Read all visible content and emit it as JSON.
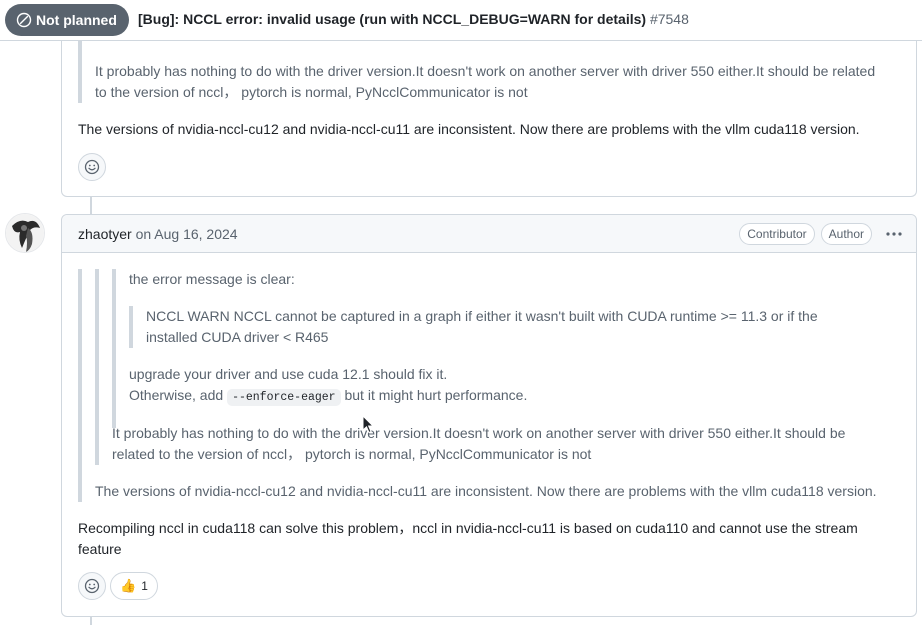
{
  "header": {
    "state": "Not planned",
    "title": "[Bug]: NCCL error: invalid usage (run with NCCL_DEBUG=WARN for details)",
    "number": "#7548"
  },
  "comment1": {
    "quote": "It probably has nothing to do with the driver version.It doesn't work on another server with driver 550 either.It should be related to the version of nccl， pytorch is normal, PyNcclCommunicator is not",
    "quote_line1": "It probably has nothing to do with the driver version.It doesn't work on another server with driver 550 either.It should be related",
    "quote_line2": "to the version of nccl， pytorch is normal, PyNcclCommunicator is not",
    "body": "The versions of nvidia-nccl-cu12 and nvidia-nccl-cu11 are inconsistent. Now there are problems with the vllm cuda118 version."
  },
  "comment2": {
    "author": "zhaotyer",
    "date": "on Aug 16, 2024",
    "labels": [
      "Contributor",
      "Author"
    ],
    "q3_intro": "the error message is clear:",
    "q4_line1": "NCCL WARN NCCL cannot be captured in a graph if either it wasn't built with CUDA runtime >= 11.3 or if the",
    "q4_line2": "installed CUDA driver < R465",
    "q3_upgrade": "upgrade your driver and use cuda 12.1 should fix it.",
    "q3_otherwise_pre": "Otherwise, add",
    "q3_code": "--enforce-eager",
    "q3_otherwise_post": "but it might hurt performance.",
    "q2_line1": "It probably has nothing to do with the driver version.It doesn't work on another server with driver 550 either.It should be",
    "q2_line2": "related to the version of nccl， pytorch is normal, PyNcclCommunicator is not",
    "q1_text": "The versions of nvidia-nccl-cu12 and nvidia-nccl-cu11 are inconsistent. Now there are problems with the vllm cuda118 version.",
    "body_line1": "Recompiling nccl in cuda118 can solve this problem，nccl in nvidia-nccl-cu11 is based on cuda110 and cannot use the stream",
    "body_line2": "feature",
    "reaction_emoji": "👍",
    "reaction_count": "1"
  }
}
